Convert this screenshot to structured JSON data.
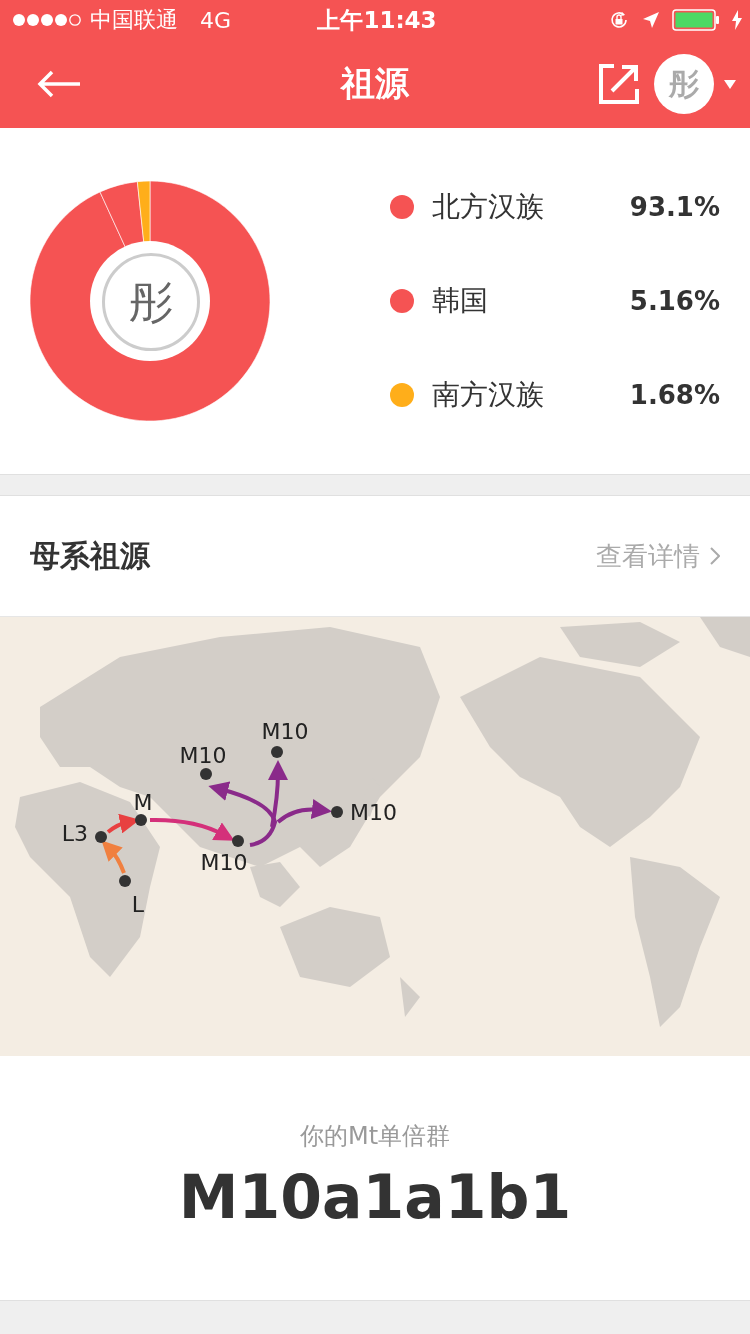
{
  "status_bar": {
    "carrier": "中国联通",
    "network": "4G",
    "time": "上午11:43"
  },
  "nav_bar": {
    "title": "祖源",
    "avatar": "彤"
  },
  "ancestry": {
    "center_avatar": "彤",
    "chart_data": {
      "type": "donut",
      "values": [
        93.1,
        5.16,
        1.68
      ]
    },
    "legend": [
      {
        "label": "北方汉族",
        "value": "93.1%",
        "color": "#f55353"
      },
      {
        "label": "韩国",
        "value": "5.16%",
        "color": "#f55353"
      },
      {
        "label": "南方汉族",
        "value": "1.68%",
        "color": "#ffae1a"
      }
    ]
  },
  "maternal": {
    "title": "母系祖源",
    "link": "查看详情",
    "map_nodes": [
      {
        "label": "L"
      },
      {
        "label": "L3"
      },
      {
        "label": "M"
      },
      {
        "label": "M10"
      },
      {
        "label": "M10"
      },
      {
        "label": "M10"
      },
      {
        "label": "M10"
      }
    ]
  },
  "haplogroup": {
    "caption": "你的Mt单倍群",
    "value": "M10a1a1b1"
  }
}
